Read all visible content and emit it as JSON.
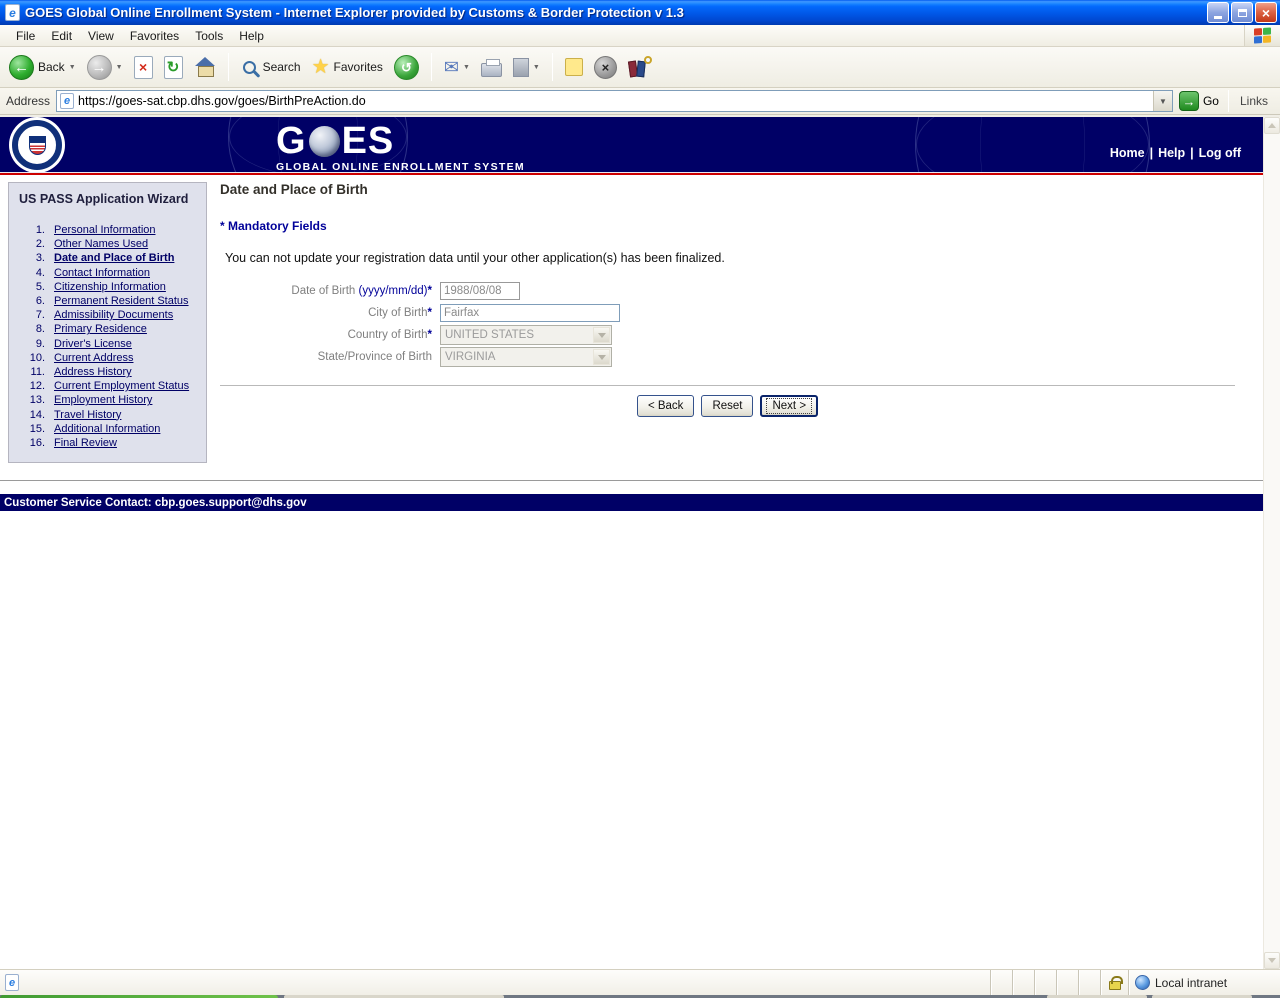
{
  "colors": {
    "navy": "#000066",
    "red_rule": "#cc0000",
    "sidebar_bg": "#dfe1ec",
    "link": "#000066",
    "titlebar_blue": "#0054e3",
    "mandatory": "#000099"
  },
  "window": {
    "title": "GOES Global Online Enrollment System - Internet Explorer provided by Customs & Border Protection v 1.3",
    "close_glyph": "×",
    "ie_glyph": "e"
  },
  "menu": {
    "items": [
      "File",
      "Edit",
      "View",
      "Favorites",
      "Tools",
      "Help"
    ]
  },
  "toolbar": {
    "back_label": "Back",
    "search_label": "Search",
    "favorites_label": "Favorites",
    "glyphs": {
      "back": "←",
      "forward": "→",
      "stop": "×",
      "refresh": "↻",
      "history": "↺",
      "mail": "✉",
      "star": "★",
      "messenger": "×",
      "dropdown": "▼"
    }
  },
  "address": {
    "label": "Address",
    "url": "https://goes-sat.cbp.dhs.gov/goes/BirthPreAction.do",
    "go": "Go",
    "go_arrow": "→",
    "links": "Links",
    "dropdown": "▼"
  },
  "site": {
    "logo_g": "G",
    "logo_es": "ES",
    "subtitle": "GLOBAL ONLINE ENROLLMENT SYSTEM",
    "nav": {
      "home": "Home",
      "sep1": "|",
      "help": "Help",
      "sep2": "|",
      "logoff": "Log off"
    }
  },
  "sidebar": {
    "title": "US PASS Application Wizard",
    "items": [
      {
        "num": "1.",
        "label": "Personal Information"
      },
      {
        "num": "2.",
        "label": "Other Names Used"
      },
      {
        "num": "3.",
        "label": "Date and Place of Birth"
      },
      {
        "num": "4.",
        "label": "Contact Information"
      },
      {
        "num": "5.",
        "label": "Citizenship Information"
      },
      {
        "num": "6.",
        "label": "Permanent Resident Status"
      },
      {
        "num": "7.",
        "label": "Admissibility Documents"
      },
      {
        "num": "8.",
        "label": "Primary Residence"
      },
      {
        "num": "9.",
        "label": "Driver's License"
      },
      {
        "num": "10.",
        "label": "Current Address"
      },
      {
        "num": "11.",
        "label": "Address History"
      },
      {
        "num": "12.",
        "label": "Current Employment Status"
      },
      {
        "num": "13.",
        "label": "Employment History"
      },
      {
        "num": "14.",
        "label": "Travel History"
      },
      {
        "num": "15.",
        "label": "Additional Information"
      },
      {
        "num": "16.",
        "label": "Final Review"
      }
    ]
  },
  "main": {
    "heading": "Date and Place of Birth",
    "mandatory": "* Mandatory Fields",
    "note": "You can not update your registration data until your other application(s) has been finalized.",
    "form": {
      "rows": [
        {
          "label": "Date of Birth ",
          "hint": "(yyyy/mm/dd)",
          "required": "*",
          "value": "1988/08/08"
        },
        {
          "label": "City of Birth",
          "hint": "",
          "required": "*",
          "value": "Fairfax"
        },
        {
          "label": "Country of Birth",
          "hint": "",
          "required": "*",
          "value": "UNITED STATES"
        },
        {
          "label": "State/Province of Birth",
          "hint": "",
          "required": "",
          "value": "VIRGINIA"
        }
      ]
    },
    "buttons": {
      "back": "< Back",
      "reset": "Reset",
      "next": "Next >"
    }
  },
  "footer": {
    "text": "Customer Service Contact: cbp.goes.support@dhs.gov"
  },
  "status": {
    "zone": "Local intranet"
  }
}
